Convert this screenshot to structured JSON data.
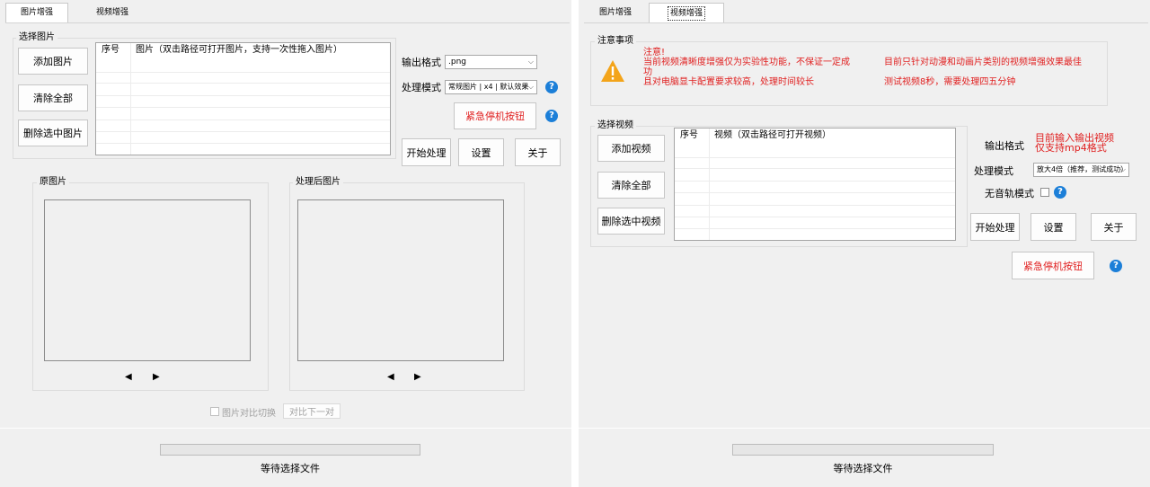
{
  "left": {
    "tabs": [
      "图片增强",
      "视频增强"
    ],
    "select_group_title": "选择图片",
    "buttons": {
      "add": "添加图片",
      "clear": "清除全部",
      "delete": "删除选中图片",
      "start": "开始处理",
      "settings": "设置",
      "about": "关于",
      "emergency": "紧急停机按钮",
      "compare_next": "对比下一对"
    },
    "list_headers": [
      "序号",
      "图片（双击路径可打开图片，支持一次性拖入图片）"
    ],
    "output_format_label": "输出格式",
    "output_format_value": ".png",
    "mode_label": "处理模式",
    "mode_value": "常规图片 | x4 | 默认效果",
    "original_title": "原图片",
    "processed_title": "处理后图片",
    "compare_toggle_label": "图片对比切换",
    "status": "等待选择文件"
  },
  "right": {
    "tabs": [
      "图片增强",
      "视频增强"
    ],
    "notice_title": "注意事项",
    "notice_lines_left": [
      "注意!",
      "当前视频清晰度增强仅为实验性功能，不保证一定成",
      "功",
      "且对电脑显卡配置要求较高，处理时间较长"
    ],
    "notice_lines_right": [
      "目前只针对动漫和动画片类别的视频增强效果最佳",
      "测试视频8秒，需要处理四五分钟"
    ],
    "select_group_title": "选择视频",
    "buttons": {
      "add": "添加视频",
      "clear": "清除全部",
      "delete": "删除选中视频",
      "start": "开始处理",
      "settings": "设置",
      "about": "关于",
      "emergency": "紧急停机按钮"
    },
    "list_headers": [
      "序号",
      "视频（双击路径可打开视频）"
    ],
    "output_format_label": "输出格式",
    "output_note_lines": [
      "目前输入输出视频",
      "仅支持mp4格式"
    ],
    "mode_label": "处理模式",
    "mode_value": "放大4倍（推荐，测试成功）",
    "mute_label": "无音轨模式",
    "status": "等待选择文件"
  },
  "icons": {
    "help": "?",
    "warning": "!",
    "chevron": "⌵",
    "prev": "◀",
    "next": "▶"
  },
  "colors": {
    "panel_bg": "#f0f0f0",
    "warning_red": "#e01e1e",
    "help_blue": "#1c7fd8",
    "warning_orange": "#f3a41a"
  }
}
